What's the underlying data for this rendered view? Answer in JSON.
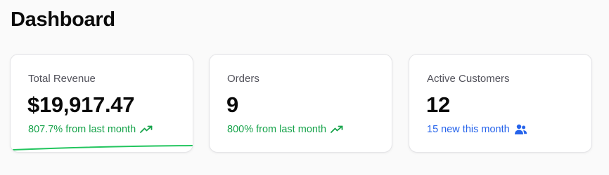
{
  "page": {
    "title": "Dashboard"
  },
  "cards": [
    {
      "label": "Total Revenue",
      "value": "$19,917.47",
      "note": "807.7% from last month",
      "note_icon": "trending-up-icon",
      "note_color": "#16a34a"
    },
    {
      "label": "Orders",
      "value": "9",
      "note": "800% from last month",
      "note_icon": "trending-up-icon",
      "note_color": "#16a34a"
    },
    {
      "label": "Active Customers",
      "value": "12",
      "note": "15 new this month",
      "note_icon": "users-icon",
      "note_color": "#2563eb"
    }
  ],
  "colors": {
    "background": "#fafafa",
    "card_border": "#e4e4e7",
    "positive": "#16a34a",
    "info": "#2563eb",
    "sparkline": "#22c55e"
  }
}
